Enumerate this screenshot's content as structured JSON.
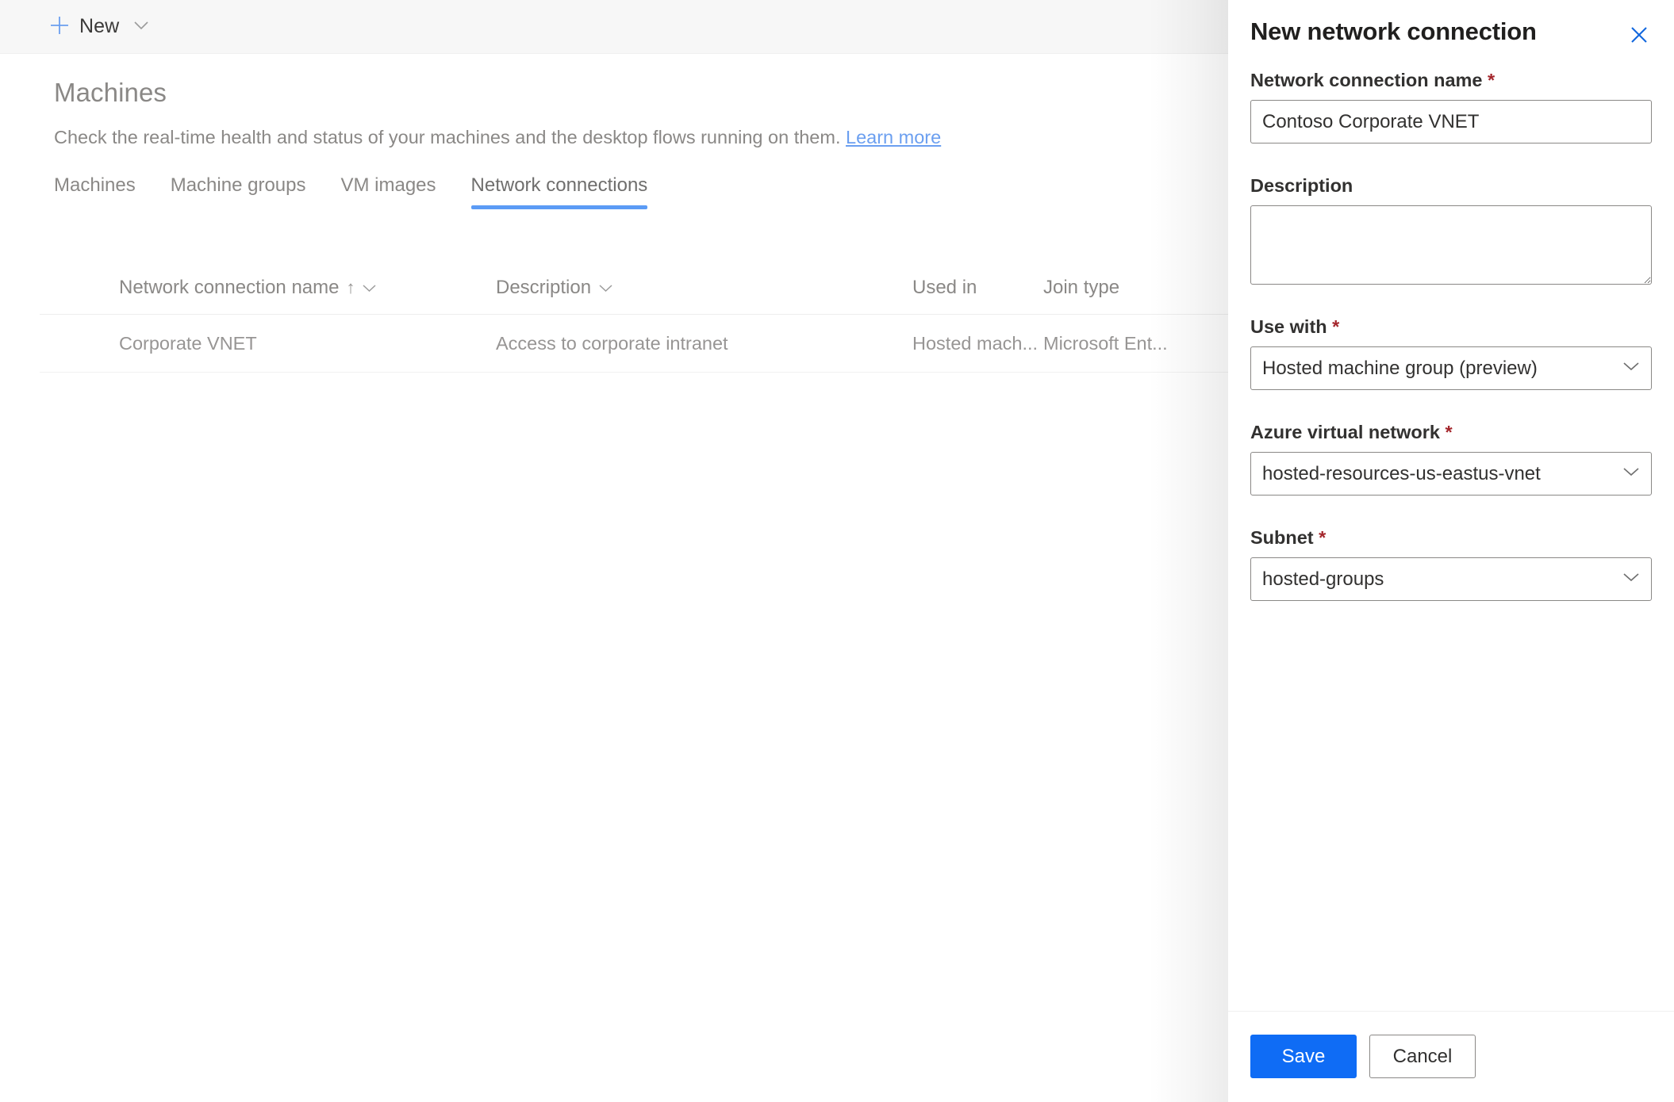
{
  "command_bar": {
    "new_label": "New",
    "plus_icon": "plus-icon",
    "chevron_icon": "chevron-down-icon"
  },
  "header": {
    "title": "Machines",
    "subtitle_text": "Check the real-time health and status of your machines and the desktop flows running on them.",
    "learn_more_label": "Learn more"
  },
  "tabs": [
    {
      "label": "Machines",
      "active": false
    },
    {
      "label": "Machine groups",
      "active": false
    },
    {
      "label": "VM images",
      "active": false
    },
    {
      "label": "Network connections",
      "active": true
    }
  ],
  "table": {
    "columns": [
      {
        "label": "Network connection name",
        "sort": "↑",
        "has_filter": true
      },
      {
        "label": "Description",
        "has_filter": true
      },
      {
        "label": "Used in",
        "has_filter": false
      },
      {
        "label": "Join type",
        "has_filter": false
      }
    ],
    "rows": [
      {
        "name": "Corporate VNET",
        "description": "Access to corporate intranet",
        "used_in": "Hosted mach...",
        "join_type": "Microsoft Ent..."
      }
    ]
  },
  "panel": {
    "title": "New network connection",
    "close_icon": "close-icon",
    "fields": {
      "connection_name": {
        "label": "Network connection name",
        "required": "*",
        "value": "Contoso Corporate VNET"
      },
      "description": {
        "label": "Description",
        "value": ""
      },
      "use_with": {
        "label": "Use with",
        "required": "*",
        "value": "Hosted machine group (preview)"
      },
      "azure_virtual_network": {
        "label": "Azure virtual network",
        "required": "*",
        "value": "hosted-resources-us-eastus-vnet"
      },
      "subnet": {
        "label": "Subnet",
        "required": "*",
        "value": "hosted-groups"
      }
    },
    "footer": {
      "save_label": "Save",
      "cancel_label": "Cancel"
    }
  },
  "colors": {
    "accent_blue": "#0f6cf5",
    "tab_underline": "#5b9bf5",
    "link_blue": "#6b9ff0",
    "required_red": "#a4262c",
    "command_bar_bg": "#f7f7f7"
  }
}
